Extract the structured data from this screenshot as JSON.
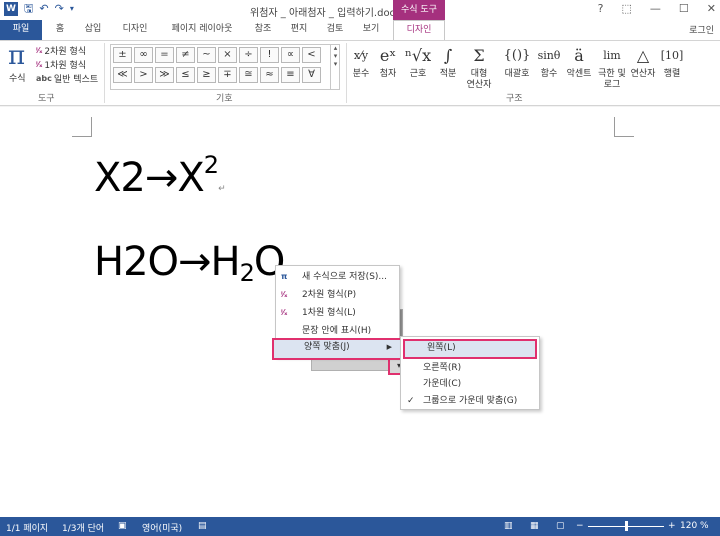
{
  "titlebar": {
    "doc_title": "위첨자 _ 아래첨자 _ 입력하기.docx - Word",
    "context_tool_header": "수식 도구",
    "qat": {
      "undo_icon": "undo-icon",
      "redo_icon": "redo-icon",
      "save_icon": "save-icon",
      "customize_icon": "chevron-down-icon"
    },
    "win": {
      "help": "?",
      "ribbon_display": "⬚",
      "minimize": "—",
      "maximize": "☐",
      "close": "✕"
    }
  },
  "tabs": [
    {
      "label": "파일"
    },
    {
      "label": "홈"
    },
    {
      "label": "삽입"
    },
    {
      "label": "디자인"
    },
    {
      "label": "페이지 레이아웃"
    },
    {
      "label": "참조"
    },
    {
      "label": "편지"
    },
    {
      "label": "검토"
    },
    {
      "label": "보기"
    },
    {
      "label": "디자인"
    }
  ],
  "login": "로그인",
  "ribbon": {
    "tools": {
      "equation": "수식",
      "pi": "π",
      "professional": "2차원 형식",
      "linear": "1차원 형식",
      "normal_text": "일반 텍스트",
      "group_label": "도구"
    },
    "symbols": {
      "row1": [
        "±",
        "∞",
        "=",
        "≠",
        "~",
        "×",
        "÷",
        "!",
        "∝",
        "<"
      ],
      "row2": [
        "≪",
        ">",
        "≫",
        "≤",
        "≥",
        "∓",
        "≅",
        "≈",
        "≡",
        "∀"
      ],
      "group_label": "기호"
    },
    "structures": {
      "items": [
        {
          "glyph": "x/y",
          "label": "분수"
        },
        {
          "glyph": "eˣ",
          "label": "첨자"
        },
        {
          "glyph": "ⁿ√x",
          "label": "근호"
        },
        {
          "glyph": "∫",
          "label": "적분"
        },
        {
          "glyph": "Σ",
          "label": "대형\n연산자"
        },
        {
          "glyph": "{()}",
          "label": "대괄호"
        },
        {
          "glyph": "sinθ",
          "label": "함수"
        },
        {
          "glyph": "ä",
          "label": "악센트"
        },
        {
          "glyph": "lim",
          "label": "극한 및\n로그"
        },
        {
          "glyph": "△",
          "label": "연산자"
        },
        {
          "glyph": "[10]",
          "label": "행렬"
        }
      ],
      "group_label": "구조"
    }
  },
  "document": {
    "line1": {
      "base": "X2→X",
      "sup": "2",
      "mark": "↵"
    },
    "line2": {
      "base": "H2O→H",
      "sub": "2",
      "tail": "O",
      "mark": "↵"
    }
  },
  "context_menu": {
    "items": [
      {
        "icon": "save-as-new-equation-icon",
        "label": "새 수식으로 저장(S)..."
      },
      {
        "icon": "professional-format-icon",
        "label": "2차원 형식(P)"
      },
      {
        "icon": "linear-format-icon",
        "label": "1차원 형식(L)"
      },
      {
        "icon": "",
        "label": "문장 안에 표시(H)"
      },
      {
        "icon": "",
        "label": "양쪽 맞춤(J)"
      }
    ],
    "submenu": [
      {
        "label": "왼쪽(L)",
        "checked": false
      },
      {
        "label": "오른쪽(R)",
        "checked": false
      },
      {
        "label": "가운데(C)",
        "checked": false
      },
      {
        "label": "그룹으로 가운데 맞춤(G)",
        "checked": true
      }
    ]
  },
  "statusbar": {
    "page": "1/1 페이지",
    "words": "1/3개 단어",
    "language": "영어(미국)",
    "zoom_minus": "−",
    "zoom_plus": "+",
    "zoom": "120 %",
    "zoom_level_percent": 120
  }
}
